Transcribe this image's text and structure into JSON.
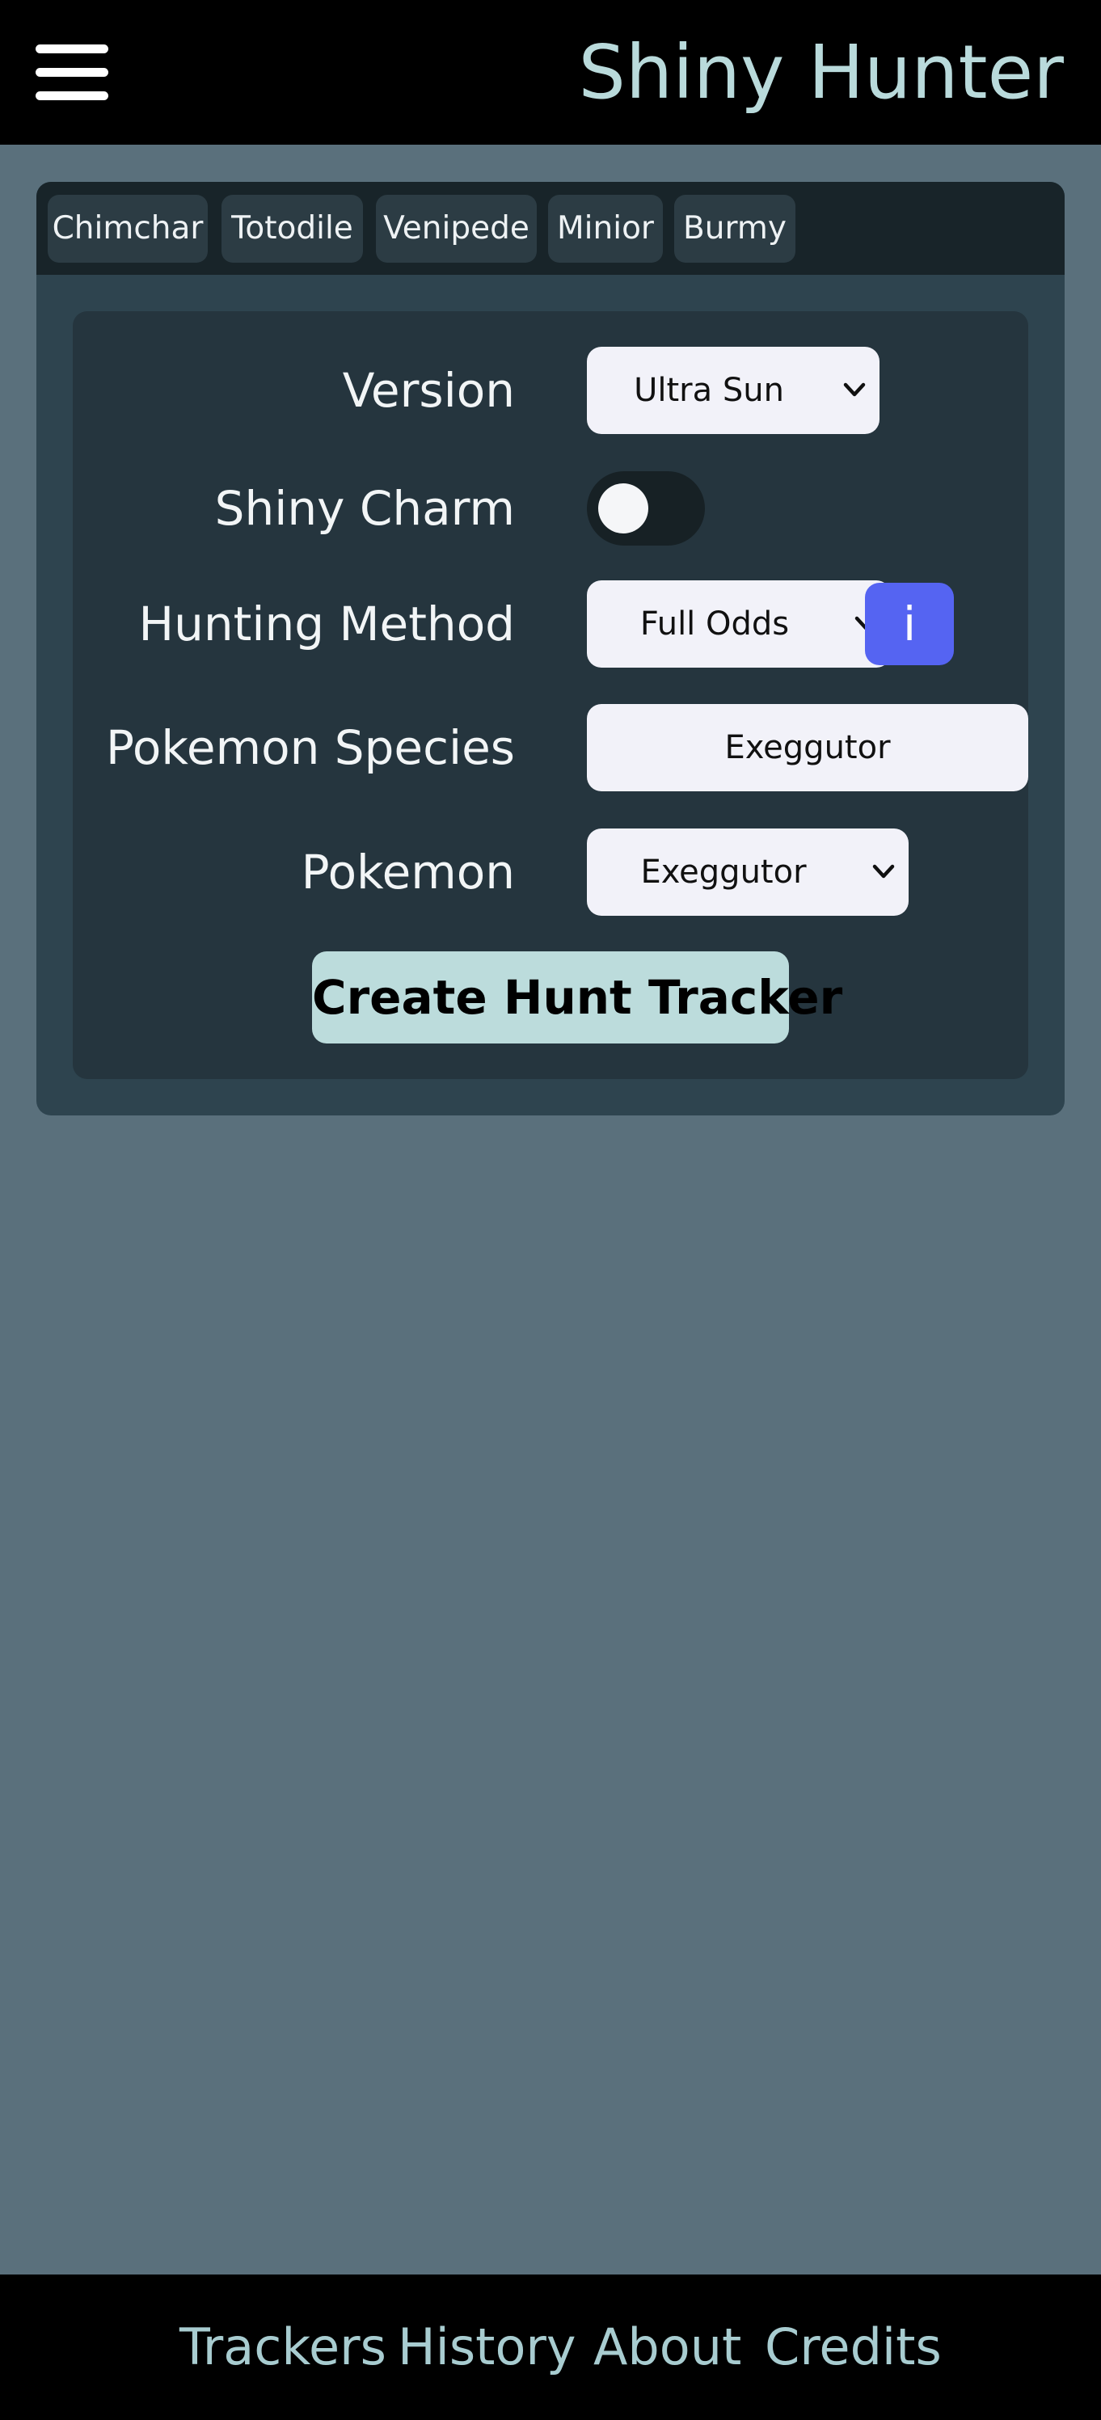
{
  "header": {
    "menu_icon": "hamburger-menu-icon",
    "title": "Shiny Hunter"
  },
  "recent_tabs": [
    "Chimchar",
    "Totodile",
    "Venipede",
    "Minior",
    "Burmy"
  ],
  "form": {
    "version": {
      "label": "Version",
      "selected": "Ultra Sun"
    },
    "shiny_charm": {
      "label": "Shiny Charm",
      "enabled": false
    },
    "hunting_method": {
      "label": "Hunting Method",
      "selected": "Full Odds",
      "info_label": "i"
    },
    "species": {
      "label": "Pokemon Species",
      "value": "Exeggutor"
    },
    "pokemon": {
      "label": "Pokemon",
      "selected": "Exeggutor"
    },
    "submit_label": "Create Hunt Tracker"
  },
  "footer": {
    "links": [
      "Trackers",
      "History",
      "About",
      "Credits"
    ]
  },
  "colors": {
    "background": "#5a707c",
    "bars": "#000000",
    "title": "#b9dadb",
    "info_button": "#5564f2",
    "create_button": "#bcdcdc",
    "footer_links": "#a8ccd0"
  }
}
